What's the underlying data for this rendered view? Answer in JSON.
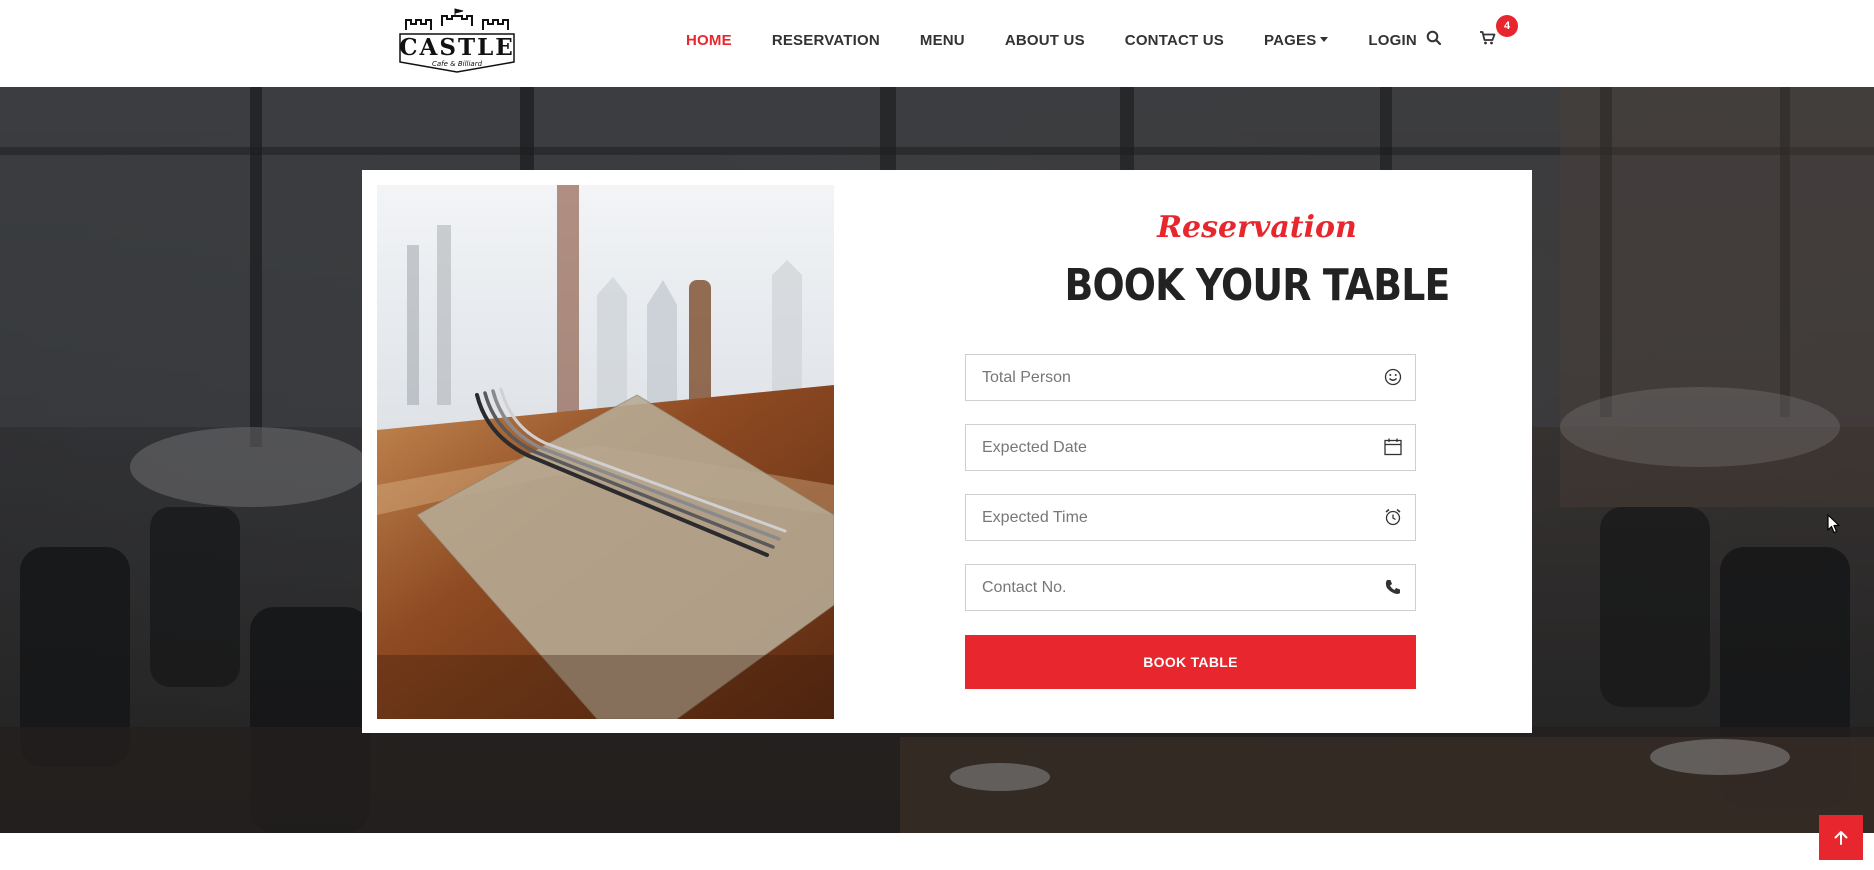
{
  "header": {
    "logo": {
      "text_main": "CASTLE",
      "text_sub": "Cafe & Billiard",
      "icon": "castle-logo"
    },
    "nav": [
      {
        "label": "HOME",
        "active": true
      },
      {
        "label": "RESERVATION",
        "active": false
      },
      {
        "label": "MENU",
        "active": false
      },
      {
        "label": "ABOUT US",
        "active": false
      },
      {
        "label": "CONTACT US",
        "active": false
      },
      {
        "label": "PAGES",
        "active": false,
        "dropdown": true
      },
      {
        "label": "LOGIN",
        "active": false
      }
    ],
    "search_icon": "search-icon",
    "cart": {
      "icon": "cart-icon",
      "count": "4"
    }
  },
  "reservation": {
    "subtitle": "Reservation",
    "title": "BOOK YOUR TABLE",
    "fields": [
      {
        "placeholder": "Total Person",
        "value": "",
        "icon": "smiley-icon"
      },
      {
        "placeholder": "Expected Date",
        "value": "",
        "icon": "calendar-icon"
      },
      {
        "placeholder": "Expected Time",
        "value": "",
        "icon": "alarm-clock-icon"
      },
      {
        "placeholder": "Contact No.",
        "value": "",
        "icon": "phone-icon"
      }
    ],
    "button_label": "BOOK TABLE"
  },
  "colors": {
    "accent": "#e8262d",
    "text_dark": "#222222",
    "nav_text": "#333333"
  },
  "scroll_top_icon": "arrow-up-icon"
}
